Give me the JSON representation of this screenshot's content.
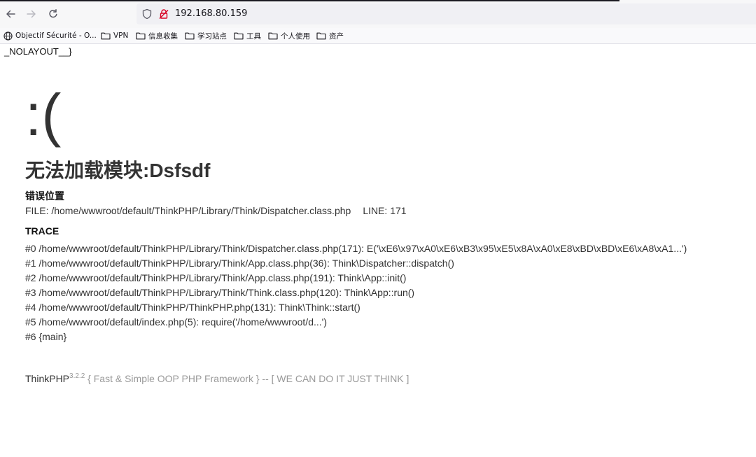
{
  "browser": {
    "url": "192.168.80.159",
    "bookmarks": [
      {
        "label": "Objectif Sécurité - O...",
        "icon": "globe-icon"
      },
      {
        "label": "VPN",
        "icon": "folder-icon"
      },
      {
        "label": "信息收集",
        "icon": "folder-icon"
      },
      {
        "label": "学习站点",
        "icon": "folder-icon"
      },
      {
        "label": "工具",
        "icon": "folder-icon"
      },
      {
        "label": "个人使用",
        "icon": "folder-icon"
      },
      {
        "label": "资产",
        "icon": "folder-icon"
      }
    ]
  },
  "page": {
    "nolayout": "_NOLAYOUT__}",
    "face": ":(",
    "error_title": "无法加载模块:Dsfsdf",
    "error_location_heading": "错误位置",
    "file_line": "FILE: /home/wwwroot/default/ThinkPHP/Library/Think/Dispatcher.class.php",
    "line_info": "LINE: 171",
    "trace_heading": "TRACE",
    "trace": [
      "#0 /home/wwwroot/default/ThinkPHP/Library/Think/Dispatcher.class.php(171): E('\\xE6\\x97\\xA0\\xE6\\xB3\\x95\\xE5\\x8A\\xA0\\xE8\\xBD\\xBD\\xE6\\xA8\\xA1...')",
      "#1 /home/wwwroot/default/ThinkPHP/Library/Think/App.class.php(36): Think\\Dispatcher::dispatch()",
      "#2 /home/wwwroot/default/ThinkPHP/Library/Think/App.class.php(191): Think\\App::init()",
      "#3 /home/wwwroot/default/ThinkPHP/Library/Think/Think.class.php(120): Think\\App::run()",
      "#4 /home/wwwroot/default/ThinkPHP/ThinkPHP.php(131): Think\\Think::start()",
      "#5 /home/wwwroot/default/index.php(5): require('/home/wwwroot/d...')",
      "#6 {main}"
    ],
    "footer": {
      "brand": "ThinkPHP",
      "version": "3.2.2",
      "tagline": " { Fast & Simple OOP PHP Framework } -- [ WE CAN DO IT JUST THINK ]"
    }
  }
}
